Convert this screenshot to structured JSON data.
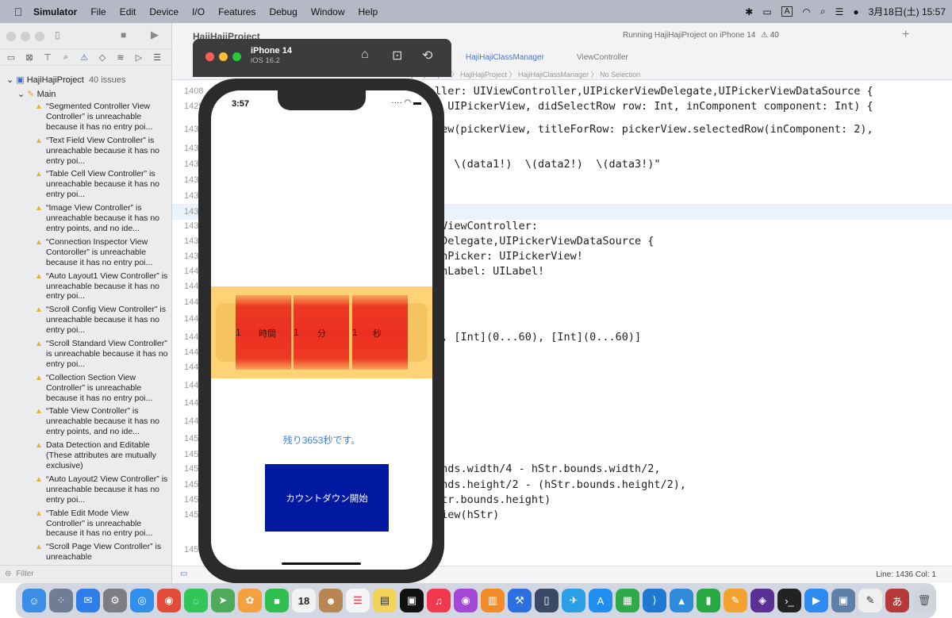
{
  "menubar": {
    "app_name": "Simulator",
    "items": [
      "File",
      "Edit",
      "Device",
      "I/O",
      "Features",
      "Debug",
      "Window",
      "Help"
    ],
    "clock": "3月18日(土) 15:57",
    "input_mode": "A"
  },
  "navigator": {
    "project_name": "HajiHajiProject",
    "issue_count": "40 issues",
    "group": "Main",
    "issues": [
      "“Segmented Controller View Controller” is unreachable because it has no entry poi...",
      "“Text Field View Controller” is unreachable because it has no entry poi...",
      "“Table Cell View Controller” is unreachable because it has no entry poi...",
      "“Image View Controller” is unreachable because it has no entry points, and no ide...",
      "“Connection Inspector View Contoroller” is unreachable because it has no entry poi...",
      "“Auto Layout1 View Controller” is unreachable because it has no entry poi...",
      "“Scroll Config View Controller” is unreachable because it has no entry poi...",
      "“Scroll Standard View Controller” is unreachable because it has no entry poi...",
      "“Collection Section View Controller” is unreachable because it has no entry poi...",
      "“Table View Controller” is unreachable because it has no entry points, and no ide...",
      "Data Detection and Editable (These attributes are mutually exclusive)",
      "“Auto Layout2 View Controller” is unreachable because it has no entry poi...",
      "“Table Edit Mode View Controller” is unreachable because it has no entry poi...",
      "“Scroll Page View Controller” is unreachable"
    ],
    "filter_placeholder": "Filter"
  },
  "editor": {
    "project_title": "HajiHajiProject",
    "run_status": "Running HajiHajiProject on iPhone 14",
    "warning_count": "40",
    "tab_active": "HajiHajiClassManager",
    "tab_other": "ViewController",
    "breadcrumb": "HajiHajiProject 〉 HajiHajiProject 〉 HajiHajiClassManager 〉 No Selection",
    "code_lines": [
      {
        "num": "1408",
        "code": "ller: UIViewController,UIPickerViewDelegate,UIPickerViewDataSource {"
      },
      {
        "num": "1429",
        "code": ": UIPickerView, didSelectRow row: Int, inComponent component: Int) {"
      },
      {
        "num": "1430",
        "code": "iew(pickerView, titleForRow: pickerView.selectedRow(inComponent: 2),"
      },
      {
        "num": "1431",
        "code": ""
      },
      {
        "num": "1432",
        "code": "R  \\(data1!)  \\(data2!)  \\(data3!)\""
      },
      {
        "num": "1433",
        "code": ""
      },
      {
        "num": "1434",
        "code": ""
      },
      {
        "num": "1436",
        "code": ""
      },
      {
        "num": "1437",
        "code": "rViewController:"
      },
      {
        "num": "1438",
        "code": "wDelegate,UIPickerViewDataSource {"
      },
      {
        "num": "1439",
        "code": "wnPicker: UIPickerView!"
      },
      {
        "num": "1440",
        "code": "wnLabel: UILabel!"
      },
      {
        "num": "1441",
        "code": ""
      },
      {
        "num": "1442",
        "code": ""
      },
      {
        "num": "1443",
        "code": ""
      },
      {
        "num": "1444",
        "code": "), [Int](0...60), [Int](0...60)]"
      },
      {
        "num": "1445",
        "code": "{"
      },
      {
        "num": "1446",
        "code": ""
      },
      {
        "num": "1447",
        "code": ""
      },
      {
        "num": "1448",
        "code": ""
      },
      {
        "num": "1449",
        "code": ""
      },
      {
        "num": "1450",
        "code": ""
      },
      {
        "num": "1451",
        "code": ""
      },
      {
        "num": "1452",
        "code": "unds.width/4 - hStr.bounds.width/2,"
      },
      {
        "num": "1453",
        "code": "unds.height/2 - (hStr.bounds.height/2),"
      },
      {
        "num": "1454",
        "code": "Str.bounds.height)"
      },
      {
        "num": "1455",
        "code": "view(hStr)"
      },
      {
        "num": "1456",
        "code": ""
      }
    ],
    "status": "Line: 1436  Col: 1"
  },
  "simulator": {
    "device_name": "iPhone 14",
    "os_version": "iOS 16.2"
  },
  "phone": {
    "time": "3:57",
    "picker": [
      {
        "value": "1",
        "unit": "時間"
      },
      {
        "value": "1",
        "unit": "分"
      },
      {
        "value": "1",
        "unit": "秒"
      }
    ],
    "remaining_label": "残り3653秒です。",
    "countdown_button": "カウントダウン開始"
  },
  "colors": {
    "picker_band": "#ffd276",
    "picker_red": "#ec3020",
    "button_blue": "#0019a0",
    "label_blue": "#3d82d8"
  },
  "dock_icons": [
    "finder-icon",
    "launchpad-icon",
    "mail-icon",
    "system-settings-icon",
    "safari-icon",
    "chrome-icon",
    "messages-icon",
    "maps-icon",
    "photos-icon",
    "facetime-icon",
    "calendar-icon",
    "contacts-icon",
    "reminders-icon",
    "notes-icon",
    "appletv-icon",
    "music-icon",
    "podcasts-icon",
    "books-icon",
    "xcode-icon",
    "simulator-icon",
    "testflight-icon",
    "appstore-icon",
    "numbers-icon",
    "vscode-icon",
    "keynote-icon",
    "numbers2-icon",
    "pages-icon",
    "github-desktop-icon",
    "terminal-icon",
    "zoom-icon",
    "preview-icon",
    "textedit-icon",
    "kotoeri-icon",
    "trash-icon"
  ],
  "dock_calendar_day": "18"
}
